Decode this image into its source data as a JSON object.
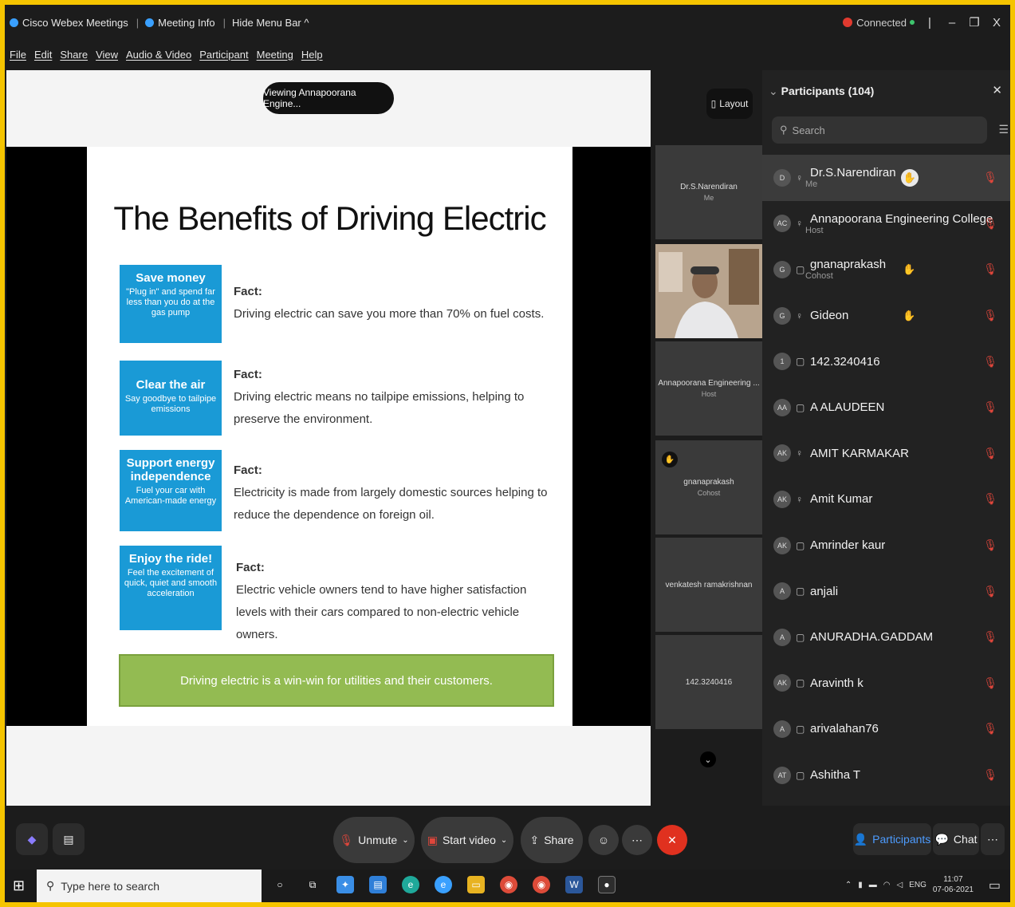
{
  "titlebar": {
    "app": "Cisco Webex Meetings",
    "meeting_info": "Meeting Info",
    "hide_menu": "Hide Menu Bar ^",
    "status": "Connected",
    "win_bar": "|",
    "win_min": "–",
    "win_restore": "❐",
    "win_close": "X"
  },
  "menubar": [
    "File",
    "Edit",
    "Share",
    "View",
    "Audio & Video",
    "Participant",
    "Meeting",
    "Help"
  ],
  "share": {
    "viewing": "Viewing Annapoorana Engine...",
    "slide": {
      "title": "The Benefits of Driving Electric",
      "benefits": [
        {
          "head": "Save money",
          "body": "\"Plug in\" and spend far less than you do at the gas pump",
          "fact_label": "Fact:",
          "fact": "Driving electric can save you more than 70% on fuel costs."
        },
        {
          "head": "Clear the air",
          "body": "Say goodbye to tailpipe emissions",
          "fact_label": "Fact:",
          "fact": "Driving electric means no tailpipe emissions, helping to preserve the environment."
        },
        {
          "head": "Support energy independence",
          "body": "Fuel your car with American-made energy",
          "fact_label": "Fact:",
          "fact": "Electricity is made from largely domestic sources helping to reduce the dependence on foreign oil."
        },
        {
          "head": "Enjoy the ride!",
          "body": "Feel the excitement of quick, quiet and smooth acceleration",
          "fact_label": "Fact:",
          "fact": "Electric vehicle owners tend to have higher satisfaction levels with their cars compared to non-electric vehicle owners."
        }
      ],
      "banner": "Driving electric is a win-win for utilities and their customers."
    }
  },
  "video_strip": {
    "layout_label": "Layout",
    "tiles": [
      {
        "name": "Dr.S.Narendiran",
        "role": "Me"
      },
      {
        "name": "",
        "role": ""
      },
      {
        "name": "Annapoorana Engineering ...",
        "role": "Host"
      },
      {
        "name": "gnanaprakash",
        "role": "Cohost"
      },
      {
        "name": "venkatesh ramakrishnan",
        "role": ""
      },
      {
        "name": "142.3240416",
        "role": ""
      }
    ]
  },
  "participants": {
    "title": "Participants (104)",
    "search_placeholder": "Search",
    "list": [
      {
        "initials": "D",
        "name": "Dr.S.Narendiran",
        "role": "Me"
      },
      {
        "initials": "AC",
        "name": "Annapoorana Engineering College",
        "role": "Host"
      },
      {
        "initials": "G",
        "name": "gnanaprakash",
        "role": "Cohost"
      },
      {
        "initials": "G",
        "name": "Gideon",
        "role": ""
      },
      {
        "initials": "1",
        "name": "142.3240416",
        "role": ""
      },
      {
        "initials": "AA",
        "name": "A ALAUDEEN",
        "role": ""
      },
      {
        "initials": "AK",
        "name": "AMIT KARMAKAR",
        "role": ""
      },
      {
        "initials": "AK",
        "name": "Amit Kumar",
        "role": ""
      },
      {
        "initials": "AK",
        "name": "Amrinder kaur",
        "role": ""
      },
      {
        "initials": "A",
        "name": "anjali",
        "role": ""
      },
      {
        "initials": "A",
        "name": "ANURADHA.GADDAM",
        "role": ""
      },
      {
        "initials": "AK",
        "name": "Aravinth k",
        "role": ""
      },
      {
        "initials": "A",
        "name": "arivalahan76",
        "role": ""
      },
      {
        "initials": "AT",
        "name": "Ashitha T",
        "role": ""
      }
    ]
  },
  "controls": {
    "unmute": "Unmute",
    "start_video": "Start video",
    "share": "Share",
    "participants": "Participants",
    "chat": "Chat"
  },
  "taskbar": {
    "search_placeholder": "Type here to search",
    "lang": "ENG",
    "time": "11:07",
    "date": "07-06-2021"
  }
}
